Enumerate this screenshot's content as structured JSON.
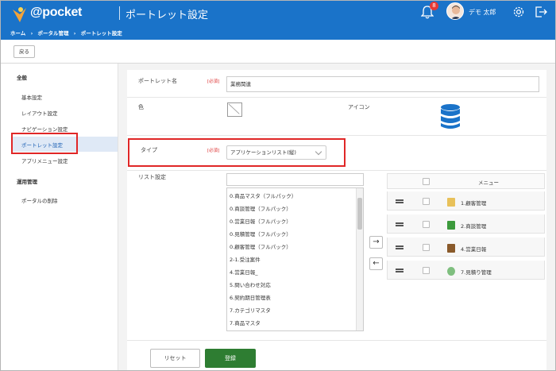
{
  "header": {
    "logo_text": "@pocket",
    "page_title": "ポートレット設定",
    "notification_count": "8",
    "user_name": "デモ 太郎",
    "breadcrumb": [
      "ホーム",
      "›",
      "ポータル管理",
      "›",
      "ポートレット設定"
    ]
  },
  "toolbar": {
    "back_label": "戻る"
  },
  "sidebar": {
    "section1": "全般",
    "items": [
      "基本設定",
      "レイアウト設定",
      "ナビゲーション設定",
      "ポートレット設定",
      "アプリメニュー設定"
    ],
    "section2": "運用管理",
    "items2": [
      "ポータルの削除"
    ]
  },
  "form": {
    "name_label": "ポートレット名",
    "required": "[必須]",
    "name_value": "業務関連",
    "color_label": "色",
    "icon_label": "アイコン",
    "type_label": "タイプ",
    "type_value": "アプリケーションリスト(縦)",
    "list_label": "リスト設定"
  },
  "list_items": [
    "0.商品マスタ（フルパック）",
    "0.商談管理（フルパック）",
    "0.営業日報（フルパック）",
    "0.見積管理（フルパック）",
    "0.顧客管理（フルパック）",
    "2-1.受注案件",
    "4.営業日報_",
    "5.問い合わせ対応",
    "6.契約期日管理表",
    "7.カテゴリマスタ",
    "7.商品マスタ"
  ],
  "arrows": {
    "right": "→",
    "left": "←"
  },
  "menu": {
    "header": "メニュー",
    "rows": [
      {
        "label": "1.顧客管理",
        "icon": "folder-people-icon",
        "color": "#e8c15a"
      },
      {
        "label": "2.商談管理",
        "icon": "green-book-icon",
        "color": "#3c9a3c"
      },
      {
        "label": "4.営業日報",
        "icon": "briefcase-icon",
        "color": "#8a5a2b"
      },
      {
        "label": "7.見積り管理",
        "icon": "clipboard-icon",
        "color": "#7fbf7f"
      }
    ]
  },
  "buttons": {
    "reset": "リセット",
    "save": "登録"
  },
  "colors": {
    "brand": "#1a73c9",
    "save": "#2e7d32",
    "highlight": "#e02727"
  }
}
